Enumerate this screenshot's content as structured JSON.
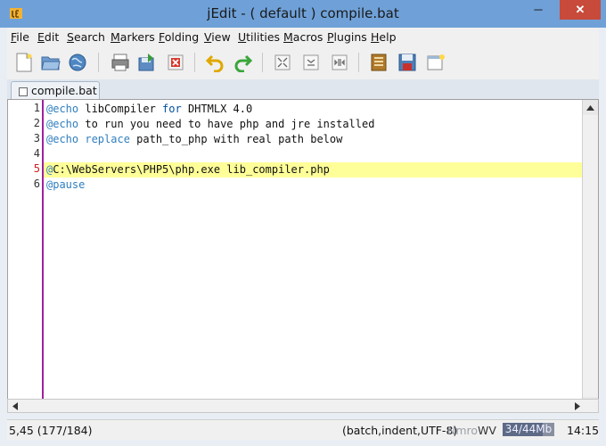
{
  "window": {
    "title": "jEdit - ( default ) compile.bat",
    "minimize_glyph": "─",
    "maximize_glyph": "□",
    "close_glyph": "✕"
  },
  "menu": [
    {
      "u": "F",
      "rest": "ile"
    },
    {
      "u": "E",
      "rest": "dit"
    },
    {
      "u": "S",
      "rest": "earch"
    },
    {
      "u": "M",
      "rest": "arkers"
    },
    {
      "u": "F",
      "rest": "olding"
    },
    {
      "u": "V",
      "rest": "iew"
    },
    {
      "u": "U",
      "rest": "tilities"
    },
    {
      "u": "M",
      "rest": "acros"
    },
    {
      "u": "P",
      "rest": "lugins"
    },
    {
      "u": "H",
      "rest": "elp"
    }
  ],
  "toolbar_icons": [
    "new-file-icon",
    "open-folder-icon",
    "globe-icon",
    "print-icon",
    "save-as-icon",
    "close-file-icon",
    "undo-icon",
    "redo-icon",
    "fold-icon",
    "collapse-icon",
    "expand-icon",
    "clipboard-icon",
    "save-icon",
    "new-view-icon"
  ],
  "tab": {
    "label": "compile.bat"
  },
  "editor": {
    "current_line": 5,
    "lines": [
      {
        "n": "1",
        "parts": [
          {
            "t": "@echo",
            "c": "kw1"
          },
          {
            "t": " libCompiler "
          },
          {
            "t": "for",
            "c": "kw2"
          },
          {
            "t": " DHTMLX 4.0"
          }
        ]
      },
      {
        "n": "2",
        "parts": [
          {
            "t": "@echo",
            "c": "kw1"
          },
          {
            "t": " to run you need to have php and jre installed"
          }
        ]
      },
      {
        "n": "3",
        "parts": [
          {
            "t": "@echo",
            "c": "kw1"
          },
          {
            "t": " "
          },
          {
            "t": "replace",
            "c": "kw1"
          },
          {
            "t": " path_to_php with real path below"
          }
        ]
      },
      {
        "n": "4",
        "parts": []
      },
      {
        "n": "5",
        "parts": [
          {
            "t": "@",
            "c": "kw1"
          },
          {
            "t": "C:\\WebServers\\PHP5\\php.exe lib_compiler.php"
          }
        ]
      },
      {
        "n": "6",
        "parts": [
          {
            "t": "@pause",
            "c": "kw1"
          }
        ]
      }
    ]
  },
  "status": {
    "position": "5,45 (177/184)",
    "mode": "(batch,indent,UTF-8)",
    "flags_dim": "Nmro",
    "flags_on": "WV",
    "memory": "34/44Mb",
    "memory_fraction": 0.77,
    "clock": "14:15"
  },
  "colors": {
    "titlebar": "#6fa1d8",
    "keyword": "#2f7fbf",
    "current_line": "#ffff99",
    "gutter_border": "#a020a0"
  }
}
